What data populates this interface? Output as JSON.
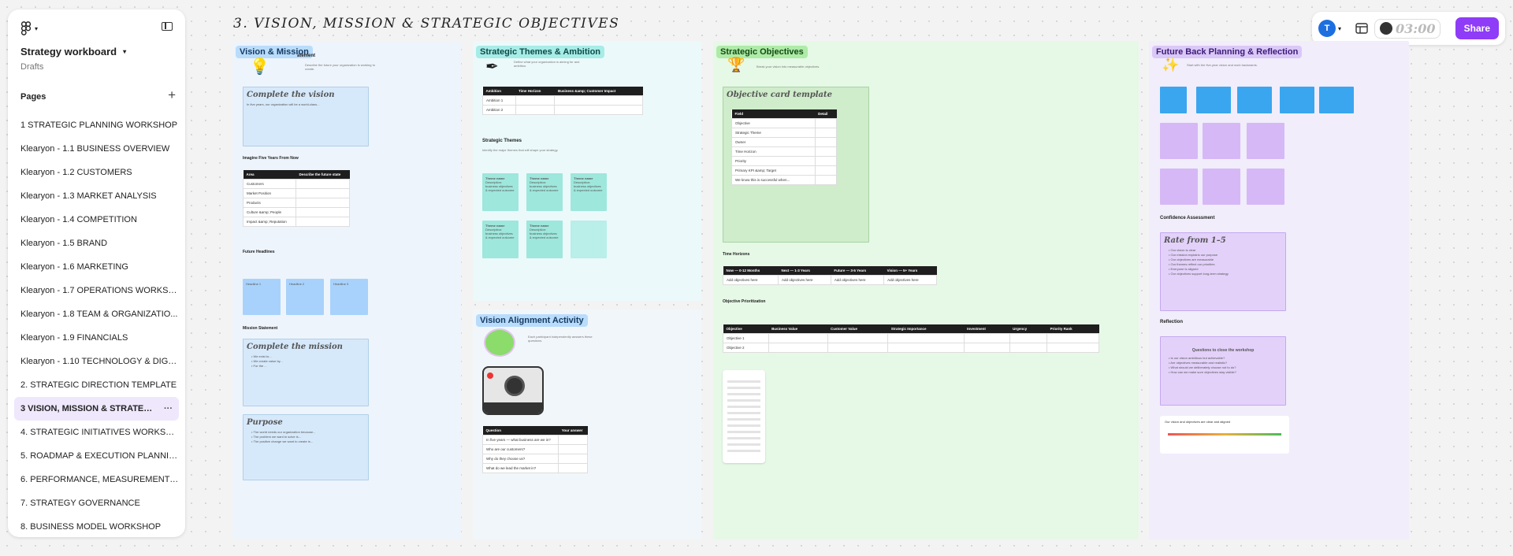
{
  "app": {
    "file_name": "Strategy workboard",
    "location": "Drafts"
  },
  "sidebar": {
    "pages_title": "Pages",
    "pages": [
      "1 STRATEGIC PLANNING WORKSHOP",
      "Klearyon - 1.1 BUSINESS OVERVIEW",
      "Klearyon - 1.2 CUSTOMERS",
      "Klearyon - 1.3 MARKET ANALYSIS",
      "Klearyon - 1.4 COMPETITION",
      "Klearyon - 1.5 BRAND",
      "Klearyon - 1.6 MARKETING",
      "Klearyon - 1.7 OPERATIONS WORKSH...",
      "Klearyon - 1.8 TEAM & ORGANIZATIO...",
      "Klearyon - 1.9 FINANCIALS",
      "Klearyon - 1.10 TECHNOLOGY & DIGIT...",
      "2. STRATEGIC DIRECTION TEMPLATE",
      "3 VISION, MISSION & STRATEGIC ...",
      "4. STRATEGIC INITIATIVES WORKSHOP",
      "5. ROADMAP & EXECUTION PLANNING",
      "6. PERFORMANCE, MEASUREMENT & ...",
      "7. STRATEGY GOVERNANCE",
      "8. BUSINESS MODEL WORKSHOP"
    ],
    "active_index": 12
  },
  "toolbar": {
    "avatar": "T",
    "timer": "03:00",
    "share": "Share"
  },
  "board": {
    "title": "3. VISION, MISSION & STRATEGIC OBJECTIVES"
  },
  "vision": {
    "label": "Vision & Mission",
    "statement": "atement",
    "vision_card": "Complete the vision",
    "vision_sub": "In five years, our organization will be a world-class...",
    "imagine": "Imagine Five Years From Now",
    "table_head": [
      "Area",
      "Describe the future state"
    ],
    "table_rows": [
      "Customers",
      "Market Position",
      "Products",
      "Culture &amp; People",
      "Impact &amp; Reputation"
    ],
    "headlines": "Future Headlines",
    "headlines_notes": [
      "Headline 1",
      "Headline 2",
      "Headline 3"
    ],
    "mission_label": "Mission Statement",
    "mission_card": "Complete the mission",
    "purpose_card": "Purpose"
  },
  "themes": {
    "label": "Strategic Themes & Ambition",
    "table_head": [
      "Ambition",
      "Time Horizon",
      "Business &amp; Customer Impact"
    ],
    "rows": [
      "Ambition 1",
      "Ambition 2"
    ],
    "themes_title": "Strategic Themes",
    "note": "Theme name",
    "note_sub": "Description: business objectives & expected outcome"
  },
  "alignment": {
    "label": "Vision Alignment Activity",
    "table_head": [
      "Question",
      "Your answer"
    ],
    "rows": [
      "In five years — what business are we in?",
      "Who are our customers?",
      "Why do they choose us?",
      "What do we lead the market in?"
    ]
  },
  "objectives": {
    "label": "Strategic Objectives",
    "card_title": "Objective card template",
    "card_head": [
      "Field",
      "Detail"
    ],
    "card_rows": [
      "Objective",
      "Strategic Theme",
      "Owner",
      "Time Horizon",
      "Priority",
      "Primary KPI &amp; Target",
      "We know this is successful when..."
    ],
    "horizons": "Time Horizons",
    "horizon_head": [
      "Now — 0-12 Months",
      "Next — 1-3 Years",
      "Future — 3-5 Years",
      "Vision — 5+ Years"
    ],
    "horizon_cell": "Add objectives here",
    "prioritization": "Objective Prioritization",
    "prio_head": [
      "Objective",
      "Business Value",
      "Customer Value",
      "Strategic Importance",
      "Investment",
      "Urgency",
      "Priority Rank"
    ],
    "prio_rows": [
      "Objective 1",
      "Objective 2"
    ]
  },
  "future": {
    "label": "Future Back Planning & Reflection",
    "confidence": "Confidence Assessment",
    "rate": "Rate from 1–5",
    "reflection": "Reflection",
    "questions": "Questions to close the workshop",
    "slider_title": "Our vision and objectives are clear and aligned"
  }
}
